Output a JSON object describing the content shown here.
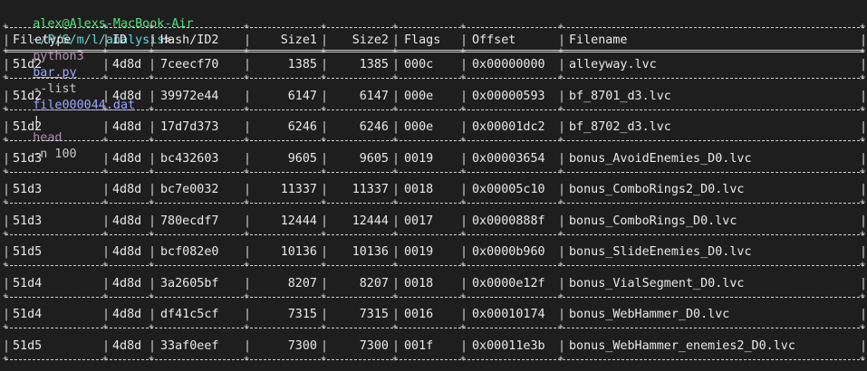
{
  "prompt": {
    "user_host": "alex@Alexs-MacBook-Air",
    "path": "~/P/S/m/l/analysis",
    "arrow": ">",
    "command": "python3",
    "script": "bar.py",
    "flag": "--list",
    "file": "file000044.dat",
    "pipe": "|",
    "pipe_cmd": "head",
    "pipe_args": "-n 100"
  },
  "table": {
    "headers": [
      "Filetype",
      "ID",
      "Hash/ID2",
      "Size1",
      "Size2",
      "Flags",
      "Offset",
      "Filename"
    ],
    "rows": [
      [
        "51d2",
        "4d8d",
        "7ceecf70",
        "1385",
        "1385",
        "000c",
        "0x00000000",
        "alleyway.lvc"
      ],
      [
        "51d2",
        "4d8d",
        "39972e44",
        "6147",
        "6147",
        "000e",
        "0x00000593",
        "bf_8701_d3.lvc"
      ],
      [
        "51d2",
        "4d8d",
        "17d7d373",
        "6246",
        "6246",
        "000e",
        "0x00001dc2",
        "bf_8702_d3.lvc"
      ],
      [
        "51d3",
        "4d8d",
        "bc432603",
        "9605",
        "9605",
        "0019",
        "0x00003654",
        "bonus_AvoidEnemies_D0.lvc"
      ],
      [
        "51d3",
        "4d8d",
        "bc7e0032",
        "11337",
        "11337",
        "0018",
        "0x00005c10",
        "bonus_ComboRings2_D0.lvc"
      ],
      [
        "51d3",
        "4d8d",
        "780ecdf7",
        "12444",
        "12444",
        "0017",
        "0x0000888f",
        "bonus_ComboRings_D0.lvc"
      ],
      [
        "51d5",
        "4d8d",
        "bcf082e0",
        "10136",
        "10136",
        "0019",
        "0x0000b960",
        "bonus_SlideEnemies_D0.lvc"
      ],
      [
        "51d4",
        "4d8d",
        "3a2605bf",
        "8207",
        "8207",
        "0018",
        "0x0000e12f",
        "bonus_VialSegment_D0.lvc"
      ],
      [
        "51d4",
        "4d8d",
        "df41c5cf",
        "7315",
        "7315",
        "0016",
        "0x00010174",
        "bonus_WebHammer_D0.lvc"
      ],
      [
        "51d5",
        "4d8d",
        "33af0eef",
        "7300",
        "7300",
        "001f",
        "0x00011e3b",
        "bonus_WebHammer_enemies2_D0.lvc"
      ]
    ]
  },
  "colors": {
    "background": "#1e1e1e",
    "user_host": "#55e07a",
    "path": "#5fd7d7",
    "command": "#b48ead",
    "link": "#9aa7ff"
  }
}
